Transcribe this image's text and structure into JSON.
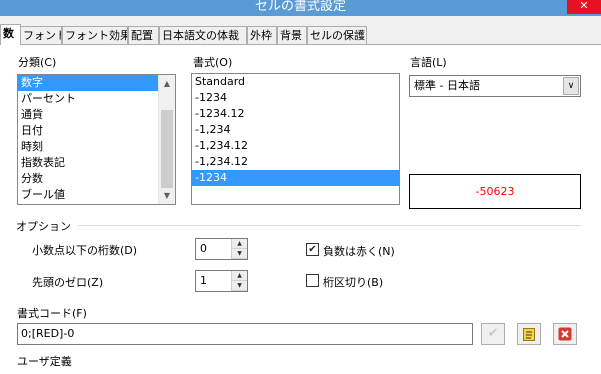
{
  "title": "セルの書式設定",
  "tabs": [
    "数",
    "フォント",
    "フォント効果",
    "配置",
    "日本語文の体裁",
    "外枠",
    "背景",
    "セルの保護"
  ],
  "category": {
    "label": "分類(C)",
    "items": [
      "数字",
      "パーセント",
      "通貨",
      "日付",
      "時刻",
      "指数表記",
      "分数",
      "ブール値"
    ],
    "selected_index": 0
  },
  "format": {
    "label": "書式(O)",
    "items": [
      "Standard",
      "-1234",
      "-1234.12",
      "-1,234",
      "-1,234.12",
      "-1,234.12",
      "-1234"
    ],
    "selected_index": 6
  },
  "language": {
    "label": "言語(L)",
    "value": "標準 - 日本語"
  },
  "preview": {
    "value": "-50623",
    "color": "#ff0000"
  },
  "options": {
    "label": "オプション",
    "decimal_places_label": "小数点以下の桁数(D)",
    "decimal_places_value": "0",
    "leading_zeros_label": "先頭のゼロ(Z)",
    "leading_zeros_value": "1",
    "negative_red_label": "負数は赤く(N)",
    "negative_red_checked": true,
    "thousands_sep_label": "桁区切り(B)",
    "thousands_sep_checked": false
  },
  "format_code": {
    "label": "書式コード(F)",
    "value": "0;[RED]-0"
  },
  "user_defined_label": "ユーザ定義",
  "colors": {
    "accent": "#3399ff",
    "titlebar": "#5b9bd5",
    "close": "#e81123",
    "preview_text": "#ff0000"
  },
  "icons": {
    "ok": "checkmark-icon",
    "comment": "note-icon",
    "delete": "delete-icon"
  }
}
